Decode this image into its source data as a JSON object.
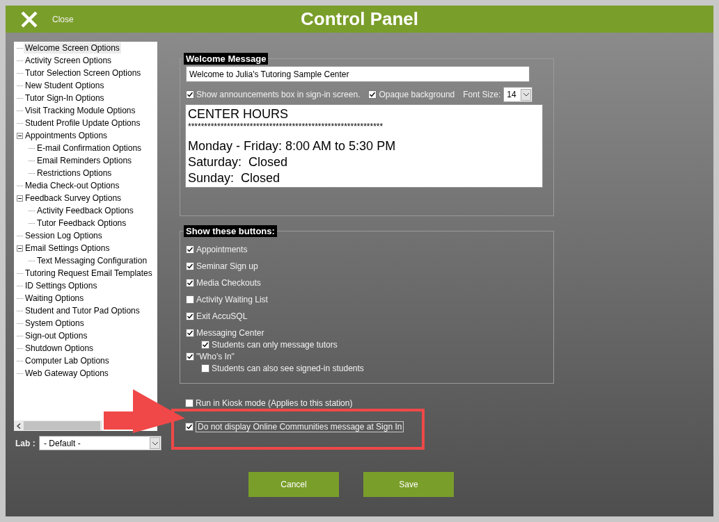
{
  "header": {
    "close_label": "Close",
    "title": "Control Panel"
  },
  "tree": {
    "items": [
      {
        "label": "Welcome Screen Options",
        "selected": true
      },
      {
        "label": "Activity Screen Options",
        "selected": false
      },
      {
        "label": "Tutor Selection Screen Options",
        "selected": false
      },
      {
        "label": "New Student Options",
        "selected": false
      },
      {
        "label": "Tutor Sign-In Options",
        "selected": false
      },
      {
        "label": "Visit Tracking Module Options",
        "selected": false
      },
      {
        "label": "Student Profile Update Options",
        "selected": false
      },
      {
        "label": "Appointments Options",
        "selected": false,
        "expanded": true,
        "children": [
          {
            "label": "E-mail Confirmation Options",
            "selected": false
          },
          {
            "label": "Email Reminders Options",
            "selected": false
          },
          {
            "label": "Restrictions Options",
            "selected": false
          }
        ]
      },
      {
        "label": "Media Check-out Options",
        "selected": false
      },
      {
        "label": "Feedback Survey Options",
        "selected": false,
        "expanded": true,
        "children": [
          {
            "label": "Activity Feedback Options",
            "selected": false
          },
          {
            "label": "Tutor Feedback Options",
            "selected": false
          }
        ]
      },
      {
        "label": "Session Log Options",
        "selected": false
      },
      {
        "label": "Email Settings Options",
        "selected": false,
        "expanded": true,
        "children": [
          {
            "label": "Text Messaging Configuration",
            "selected": false
          }
        ]
      },
      {
        "label": "Tutoring Request Email Templates",
        "selected": false
      },
      {
        "label": "ID Settings Options",
        "selected": false
      },
      {
        "label": "Waiting Options",
        "selected": false
      },
      {
        "label": "Student and Tutor Pad Options",
        "selected": false
      },
      {
        "label": "System Options",
        "selected": false
      },
      {
        "label": "Sign-out Options",
        "selected": false
      },
      {
        "label": "Shutdown Options",
        "selected": false
      },
      {
        "label": "Computer Lab Options",
        "selected": false
      },
      {
        "label": "Web Gateway Options",
        "selected": false
      }
    ]
  },
  "lab": {
    "label": "Lab :",
    "value": "- Default -"
  },
  "welcome": {
    "legend": "Welcome Message",
    "message": "Welcome to Julia's Tutoring Sample Center",
    "options": [
      {
        "label": "Show announcements box in sign-in screen.",
        "checked": true
      },
      {
        "label": "Opaque background",
        "checked": true
      }
    ],
    "font_size": {
      "label": "Font Size:",
      "value": "14"
    },
    "announcement": [
      {
        "kind": "large",
        "text": "CENTER HOURS"
      },
      {
        "kind": "small",
        "text": "************************************************************"
      },
      {
        "kind": "large",
        "text": "Monday - Friday: 8:00 AM to 5:30 PM"
      },
      {
        "kind": "large",
        "text": "Saturday:  Closed"
      },
      {
        "kind": "large",
        "text": "Sunday:  Closed"
      }
    ]
  },
  "show_buttons": {
    "legend": "Show these buttons:",
    "items": [
      {
        "label": "Appointments",
        "checked": true
      },
      {
        "label": "Seminar Sign up",
        "checked": true
      },
      {
        "label": "Media Checkouts",
        "checked": true
      },
      {
        "label": "Activity Waiting List",
        "checked": false
      },
      {
        "label": "Exit AccuSQL",
        "checked": true
      },
      {
        "label": "Messaging Center",
        "checked": true,
        "children": [
          {
            "label": "Students can only message tutors",
            "checked": true
          }
        ]
      },
      {
        "label": "\"Who's In\"",
        "checked": true,
        "children": [
          {
            "label": "Students can also see signed-in students",
            "checked": false
          }
        ]
      }
    ]
  },
  "kiosk": {
    "label": "Run in Kiosk mode (Applies to this station)",
    "checked": false
  },
  "online_communities": {
    "label": "Do not display Online Communities message at Sign In",
    "checked": true
  },
  "actions": [
    {
      "label": "Cancel"
    },
    {
      "label": "Save"
    }
  ]
}
